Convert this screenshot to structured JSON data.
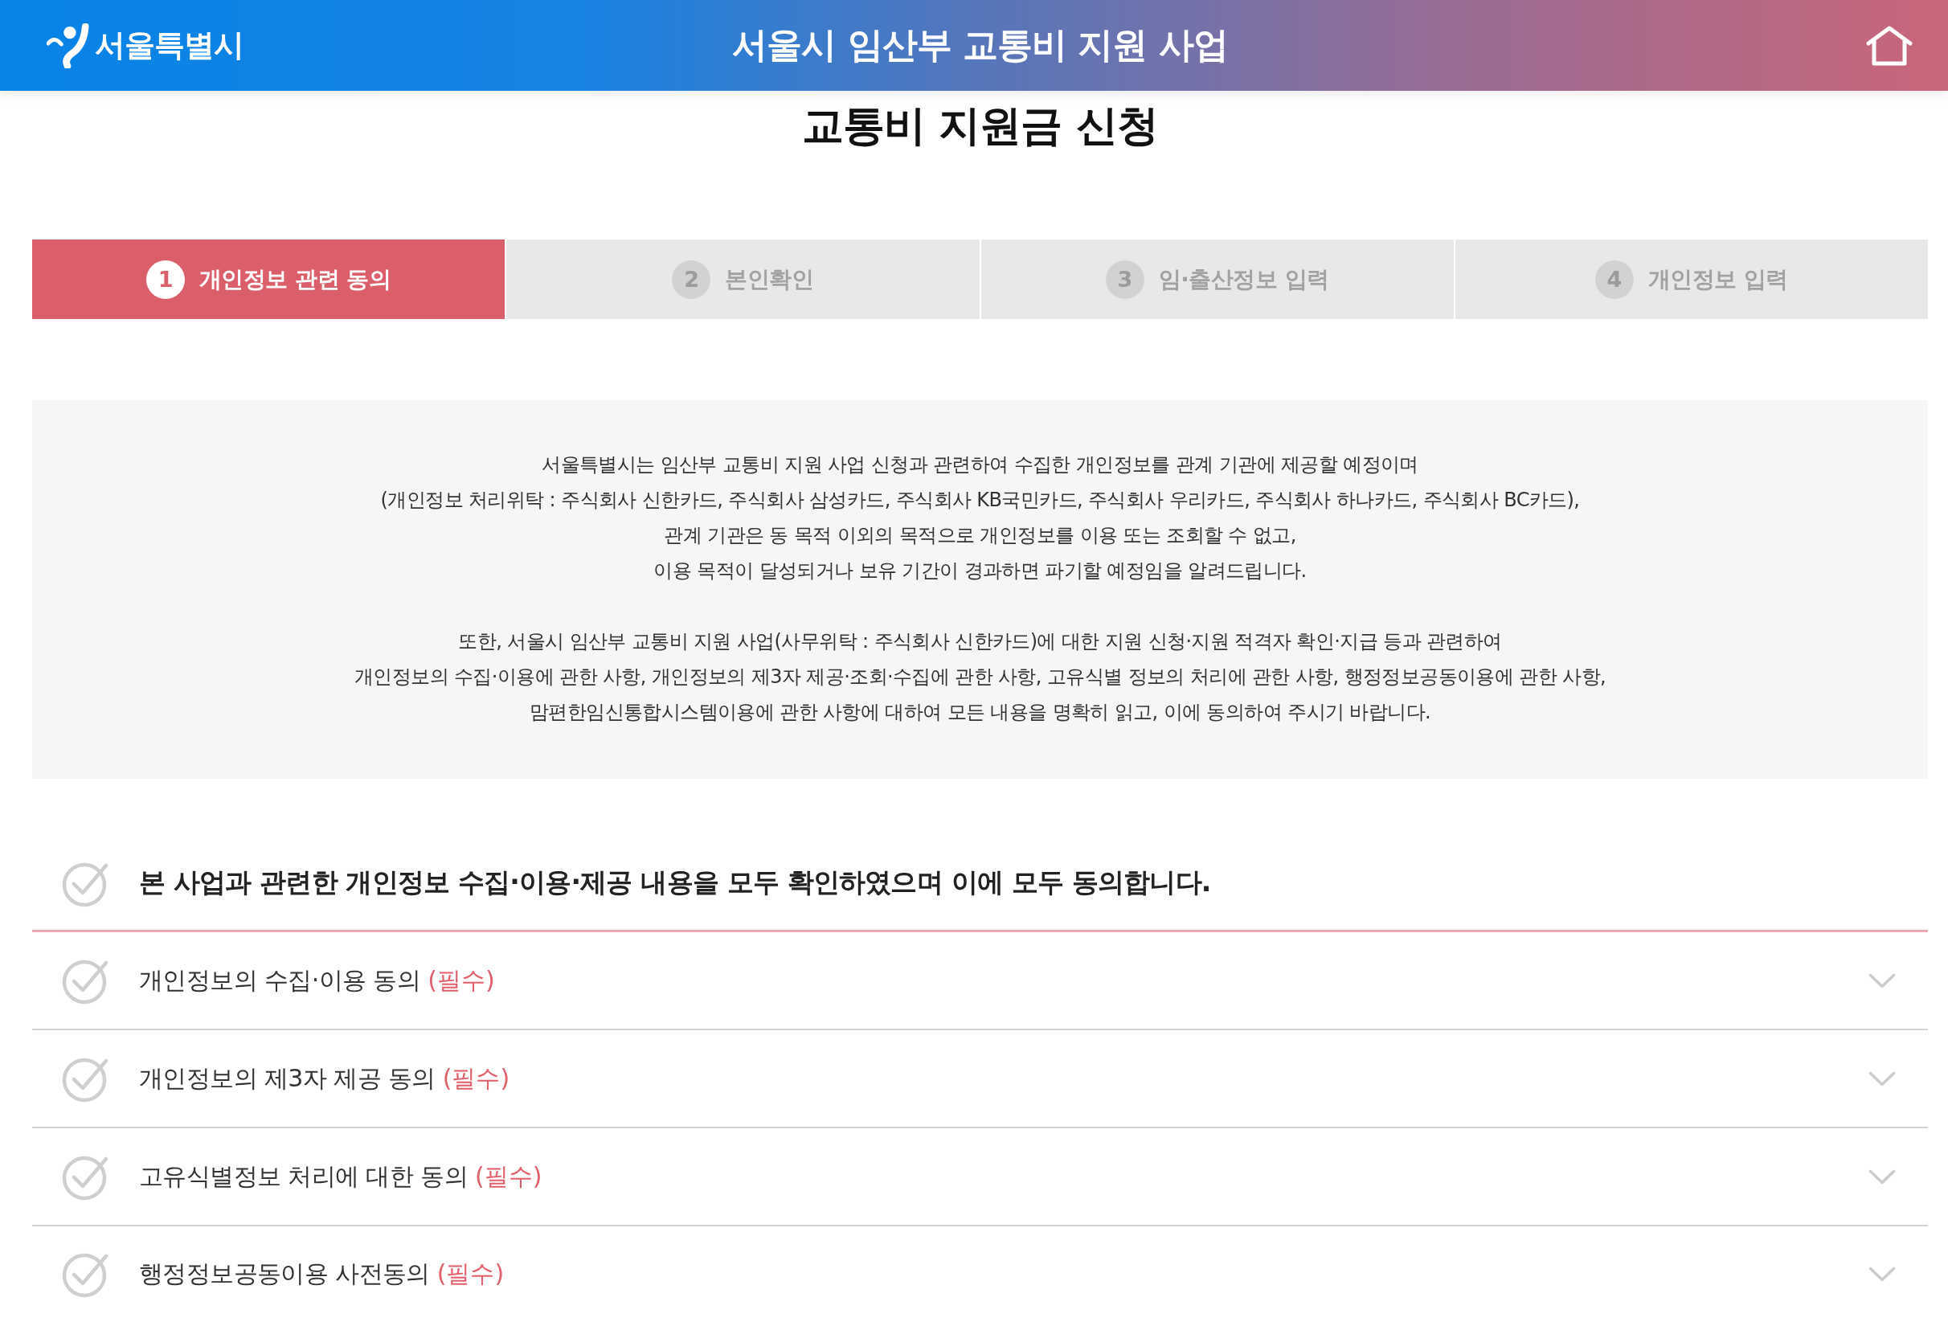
{
  "header": {
    "logo_text": "서울특별시",
    "title": "서울시 임산부 교통비 지원 사업"
  },
  "page_title": "교통비 지원금 신청",
  "steps": [
    {
      "number": "1",
      "label": "개인정보 관련 동의",
      "selected": true
    },
    {
      "number": "2",
      "label": "본인확인",
      "selected": false
    },
    {
      "number": "3",
      "label": "임·출산정보 입력",
      "selected": false
    },
    {
      "number": "4",
      "label": "개인정보 입력",
      "selected": false
    }
  ],
  "notice": {
    "paragraphs": [
      [
        "서울특별시는 임산부 교통비 지원 사업 신청과 관련하여 수집한 개인정보를 관계 기관에 제공할 예정이며",
        "(개인정보 처리위탁 : 주식회사 신한카드, 주식회사 삼성카드, 주식회사 KB국민카드, 주식회사 우리카드, 주식회사 하나카드, 주식회사 BC카드),",
        "관계 기관은 동 목적 이외의 목적으로 개인정보를 이용 또는 조회할 수 없고,",
        "이용 목적이 달성되거나 보유 기간이 경과하면 파기할 예정임을 알려드립니다."
      ],
      [
        "또한, 서울시 임산부 교통비 지원 사업(사무위탁 : 주식회사 신한카드)에 대한 지원 신청·지원 적격자 확인·지급 등과 관련하여",
        "개인정보의 수집·이용에 관한 사항, 개인정보의 제3자 제공·조회·수집에 관한 사항, 고유식별 정보의 처리에 관한 사항, 행정정보공동이용에 관한 사항,",
        "맘편한임신통합시스템이용에 관한 사항에 대하여 모든 내용을 명확히 읽고, 이에 동의하여 주시기 바랍니다."
      ]
    ]
  },
  "agree_all": {
    "label": "본 사업과 관련한 개인정보 수집·이용·제공 내용을 모두 확인하였으며 이에 모두 동의합니다.",
    "checked": false
  },
  "agreements": [
    {
      "label": "개인정보의 수집·이용 동의",
      "tag": "(필수)",
      "checked": false,
      "expanded": false
    },
    {
      "label": "개인정보의 제3자 제공 동의",
      "tag": "(필수)",
      "checked": false,
      "expanded": false
    },
    {
      "label": "고유식별정보 처리에 대한 동의",
      "tag": "(필수)",
      "checked": false,
      "expanded": false
    },
    {
      "label": "행정정보공동이용 사전동의",
      "tag": "(필수)",
      "checked": false,
      "expanded": false
    }
  ]
}
